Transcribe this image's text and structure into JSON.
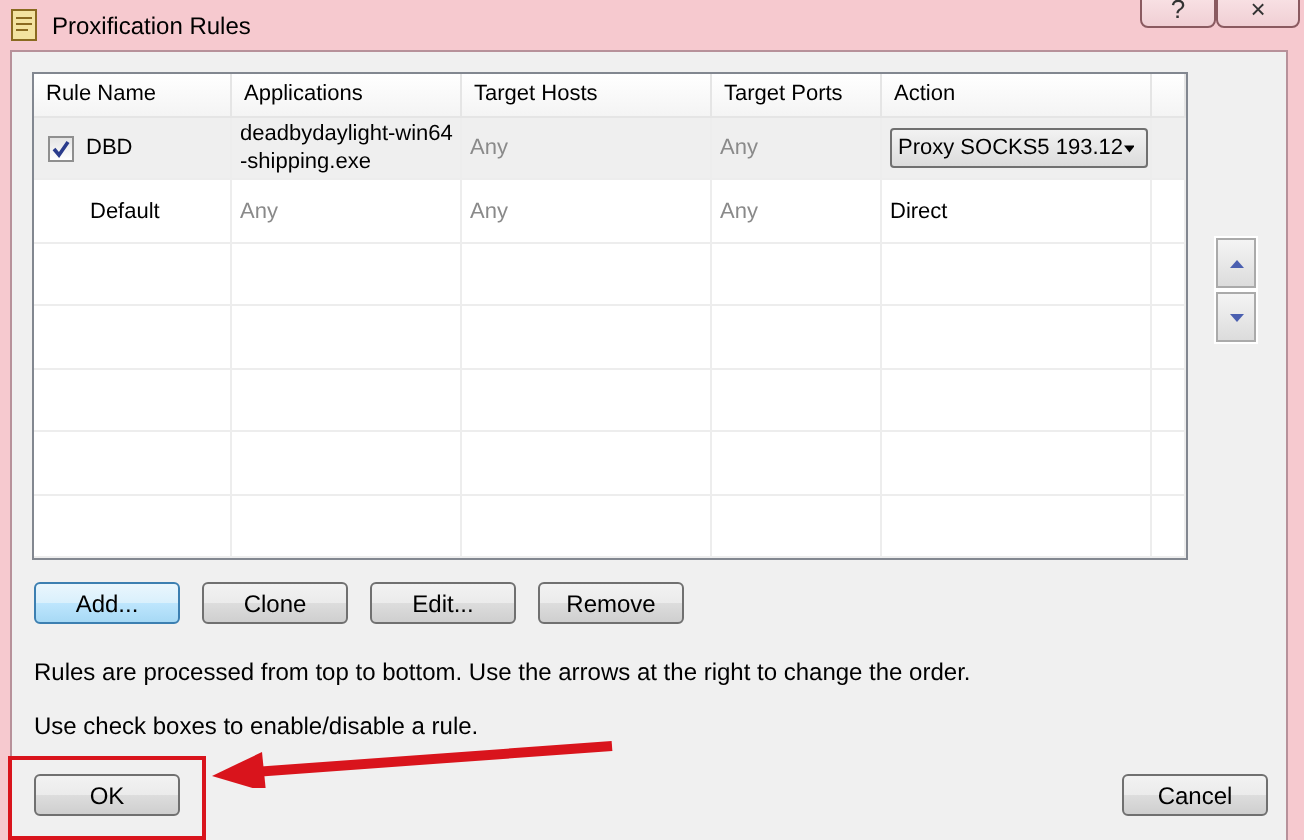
{
  "window": {
    "title": "Proxification Rules",
    "controls": [
      "?",
      "×"
    ]
  },
  "table": {
    "columns": [
      "Rule Name",
      "Applications",
      "Target Hosts",
      "Target Ports",
      "Action"
    ],
    "rows": [
      {
        "name": "DBD",
        "checked": true,
        "selected": true,
        "applications": {
          "text": "deadbydaylight-win64-shipping.exe",
          "muted": false
        },
        "target_hosts": {
          "text": "Any",
          "muted": true
        },
        "target_ports": {
          "text": "Any",
          "muted": true
        },
        "action": {
          "kind": "dropdown",
          "text": "Proxy SOCKS5 193.12"
        }
      },
      {
        "name": "Default",
        "selected": false,
        "applications": {
          "text": "Any",
          "muted": true
        },
        "target_hosts": {
          "text": "Any",
          "muted": true
        },
        "target_ports": {
          "text": "Any",
          "muted": true
        },
        "action": {
          "kind": "text",
          "text": "Direct"
        }
      }
    ]
  },
  "order_buttons": [
    {
      "kind": "up"
    },
    {
      "kind": "down"
    }
  ],
  "buttons": [
    {
      "label": "Add...",
      "default": true
    },
    {
      "label": "Clone",
      "default": false
    },
    {
      "label": "Edit...",
      "default": false
    },
    {
      "label": "Remove",
      "default": false
    }
  ],
  "notes": [
    "Rules are processed from top to bottom. Use the arrows at the right to change the order.",
    "Use check boxes to enable/disable a rule."
  ],
  "footer_buttons": [
    {
      "label": "OK",
      "highlighted": true
    },
    {
      "label": "Cancel",
      "highlighted": false
    }
  ]
}
